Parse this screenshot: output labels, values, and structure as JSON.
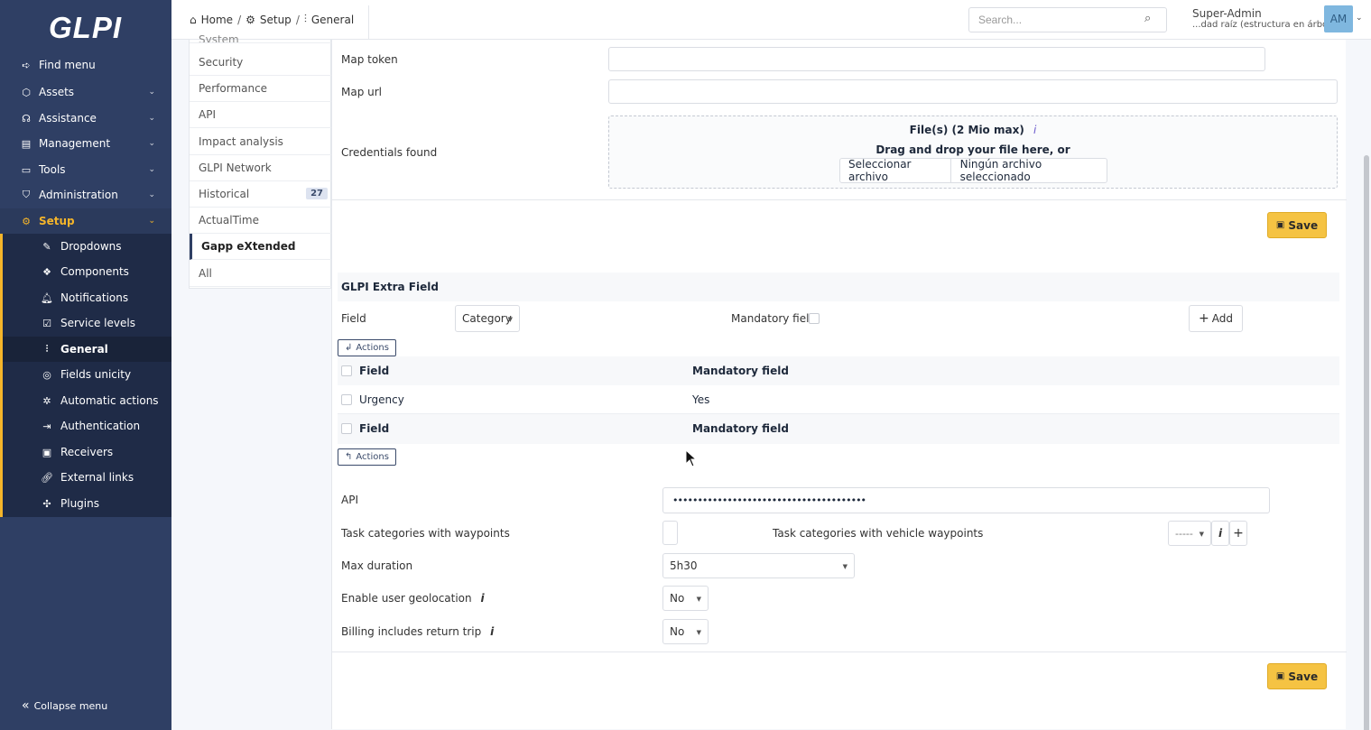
{
  "sidebar": {
    "logo": "GLPI",
    "menu": [
      {
        "label": "Find menu",
        "icon": "arrow-right-icon"
      },
      {
        "label": "Assets",
        "icon": "box-icon"
      },
      {
        "label": "Assistance",
        "icon": "headset-icon"
      },
      {
        "label": "Management",
        "icon": "wallet-icon"
      },
      {
        "label": "Tools",
        "icon": "briefcase-icon"
      },
      {
        "label": "Administration",
        "icon": "shield-icon"
      },
      {
        "label": "Setup",
        "icon": "gear-icon"
      }
    ],
    "submenu": [
      {
        "label": "Dropdowns",
        "icon": "edit-icon"
      },
      {
        "label": "Components",
        "icon": "components-icon"
      },
      {
        "label": "Notifications",
        "icon": "bell-icon"
      },
      {
        "label": "Service levels",
        "icon": "clipboard-check-icon"
      },
      {
        "label": "General",
        "icon": "sliders-icon"
      },
      {
        "label": "Fields unicity",
        "icon": "fingerprint-icon"
      },
      {
        "label": "Automatic actions",
        "icon": "settings-automation-icon"
      },
      {
        "label": "Authentication",
        "icon": "login-icon"
      },
      {
        "label": "Receivers",
        "icon": "inbox-icon"
      },
      {
        "label": "External links",
        "icon": "link-icon"
      },
      {
        "label": "Plugins",
        "icon": "puzzle-icon"
      }
    ],
    "collapse_label": "Collapse menu"
  },
  "header": {
    "breadcrumb": [
      "Home",
      "Setup",
      "General"
    ],
    "search_placeholder": "Search...",
    "user_name": "Super-Admin",
    "user_entity": "...dad raíz (estructura en árbol)",
    "avatar_initials": "AM"
  },
  "tabs": {
    "partial_top": "System",
    "items": [
      "Security",
      "Performance",
      "API",
      "Impact analysis",
      "GLPI Network",
      "Historical",
      "ActualTime",
      "Gapp eXtended",
      "All"
    ],
    "historical_badge": "27",
    "active": "Gapp eXtended"
  },
  "form": {
    "map_token_label": "Map token",
    "map_url_label": "Map url",
    "credentials_label": "Credentials found",
    "upload_title": "File(s) (2 Mio max)",
    "upload_info": "i",
    "upload_hint": "Drag and drop your file here, or",
    "file_button": "Seleccionar archivo",
    "file_none": "Ningún archivo seleccionado",
    "save_label": "Save"
  },
  "extra_field": {
    "title": "GLPI Extra Field",
    "field_label": "Field",
    "field_value": "Category",
    "mandatory_label": "Mandatory field",
    "add_label": "Add",
    "actions_label": "Actions",
    "table": {
      "headers": [
        "Field",
        "Mandatory field"
      ],
      "rows": [
        [
          "Urgency",
          "Yes"
        ]
      ]
    }
  },
  "settings": {
    "api_label": "API",
    "api_value": "•••••••••••••••••••••••••••••••••••••••",
    "task_categories_label": "Task categories with waypoints",
    "vehicle_label": "Task categories with vehicle waypoints",
    "vehicle_value": "-----",
    "max_duration_label": "Max duration",
    "max_duration_value": "5h30",
    "geolocation_label": "Enable user geolocation",
    "geolocation_value": "No",
    "billing_label": "Billing includes return trip",
    "billing_value": "No"
  },
  "colors": {
    "sidebar_bg": "#2f3f64",
    "accent": "#f5b52a",
    "save_bg": "#f5c343"
  }
}
